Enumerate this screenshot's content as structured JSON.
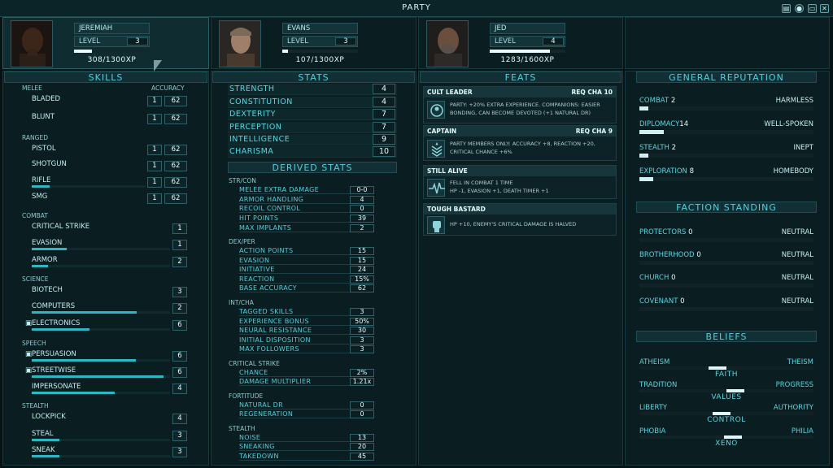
{
  "window": {
    "title": "PARTY"
  },
  "characters": [
    {
      "name": "JEREMIAH",
      "level_label": "LEVEL",
      "level": "3",
      "xp": "308/1300XP",
      "xp_fraction": 0.24
    },
    {
      "name": "EVANS",
      "level_label": "LEVEL",
      "level": "3",
      "xp": "107/1300XP",
      "xp_fraction": 0.08
    },
    {
      "name": "JED",
      "level_label": "LEVEL",
      "level": "4",
      "xp": "1283/1600XP",
      "xp_fraction": 0.8
    }
  ],
  "skills": {
    "title": "SKILLS",
    "accuracy_label": "ACCURACY",
    "melee_label": "MELEE",
    "ranged_label": "RANGED",
    "combat_label": "COMBAT",
    "science_label": "SCIENCE",
    "speech_label": "SPEECH",
    "stealth_label": "STEALTH",
    "bladed": {
      "label": "BLADED",
      "value": "1",
      "acc": "62"
    },
    "blunt": {
      "label": "BLUNT",
      "value": "1",
      "acc": "62"
    },
    "pistol": {
      "label": "PISTOL",
      "value": "1",
      "acc": "62"
    },
    "shotgun": {
      "label": "SHOTGUN",
      "value": "1",
      "acc": "62"
    },
    "rifle": {
      "label": "RIFLE",
      "value": "1",
      "acc": "62"
    },
    "smg": {
      "label": "SMG",
      "value": "1",
      "acc": "62"
    },
    "critical_strike": {
      "label": "CRITICAL STRIKE",
      "value": "1"
    },
    "evasion": {
      "label": "EVASION",
      "value": "1"
    },
    "armor": {
      "label": "ARMOR",
      "value": "2"
    },
    "biotech": {
      "label": "BIOTECH",
      "value": "3"
    },
    "computers": {
      "label": "COMPUTERS",
      "value": "2"
    },
    "electronics": {
      "label": "ELECTRONICS",
      "value": "6"
    },
    "persuasion": {
      "label": "PERSUASION",
      "value": "6"
    },
    "streetwise": {
      "label": "STREETWISE",
      "value": "6"
    },
    "impersonate": {
      "label": "IMPERSONATE",
      "value": "4"
    },
    "lockpick": {
      "label": "LOCKPICK",
      "value": "4"
    },
    "steal": {
      "label": "STEAL",
      "value": "3"
    },
    "sneak": {
      "label": "SNEAK",
      "value": "3"
    }
  },
  "stats": {
    "title": "STATS",
    "strength": {
      "label": "STRENGTH",
      "value": "4"
    },
    "constitution": {
      "label": "CONSTITUTION",
      "value": "4"
    },
    "dexterity": {
      "label": "DEXTERITY",
      "value": "7"
    },
    "perception": {
      "label": "PERCEPTION",
      "value": "7"
    },
    "intelligence": {
      "label": "INTELLIGENCE",
      "value": "9"
    },
    "charisma": {
      "label": "CHARISMA",
      "value": "10"
    }
  },
  "derived": {
    "title": "DERIVED STATS",
    "str_con": "STR/CON",
    "dex_per": "DEX/PER",
    "int_cha": "INT/CHA",
    "critical_strike": "CRITICAL STRIKE",
    "fortitude": "FORTITUDE",
    "stealth": "STEALTH",
    "melee_extra_damage": {
      "label": "MELEE EXTRA DAMAGE",
      "value": "0-0"
    },
    "armor_handling": {
      "label": "ARMOR HANDLING",
      "value": "4"
    },
    "recoil_control": {
      "label": "RECOIL CONTROL",
      "value": "0"
    },
    "hit_points": {
      "label": "HIT POINTS",
      "value": "39"
    },
    "max_implants": {
      "label": "MAX IMPLANTS",
      "value": "2"
    },
    "action_points": {
      "label": "ACTION POINTS",
      "value": "15"
    },
    "evasion": {
      "label": "EVASION",
      "value": "15"
    },
    "initiative": {
      "label": "INITIATIVE",
      "value": "24"
    },
    "reaction": {
      "label": "REACTION",
      "value": "15%"
    },
    "base_accuracy": {
      "label": "BASE ACCURACY",
      "value": "62"
    },
    "tagged_skills": {
      "label": "TAGGED SKILLS",
      "value": "3"
    },
    "experience_bonus": {
      "label": "EXPERIENCE BONUS",
      "value": "50%"
    },
    "neural_resistance": {
      "label": "NEURAL RESISTANCE",
      "value": "30"
    },
    "initial_disposition": {
      "label": "INITIAL DISPOSITION",
      "value": "3"
    },
    "max_followers": {
      "label": "MAX FOLLOWERS",
      "value": "3"
    },
    "chance": {
      "label": "CHANCE",
      "value": "2%"
    },
    "damage_multiplier": {
      "label": "DAMAGE MULTIPLIER",
      "value": "1.21x"
    },
    "natural_dr": {
      "label": "NATURAL DR",
      "value": "0"
    },
    "regeneration": {
      "label": "REGENERATION",
      "value": "0"
    },
    "noise": {
      "label": "NOISE",
      "value": "13"
    },
    "sneaking": {
      "label": "SNEAKING",
      "value": "20"
    },
    "takedown": {
      "label": "TAKEDOWN",
      "value": "45"
    }
  },
  "feats": {
    "title": "FEATS",
    "cult_leader": {
      "name": "CULT LEADER",
      "req": "REQ CHA 10",
      "desc": "PARTY: +20% EXTRA EXPERIENCE. COMPANIONS: EASIER BONDING, CAN BECOME DEVOTED (+1 NATURAL DR)"
    },
    "captain": {
      "name": "CAPTAIN",
      "req": "REQ CHA 9",
      "desc": "PARTY MEMBERS ONLY: ACCURACY +8, REACTION +20, CRITICAL CHANCE +6%"
    },
    "still_alive": {
      "name": "STILL ALIVE",
      "desc1": "FELL IN COMBAT 1 TIME",
      "desc2": "HP -1, EVASION +1, DEATH TIMER +1"
    },
    "tough_bastard": {
      "name": "TOUGH BASTARD",
      "desc": "HP +10, ENEMY'S CRITICAL DAMAGE IS HALVED"
    }
  },
  "reputation": {
    "title": "GENERAL REPUTATION",
    "combat": {
      "label": "COMBAT",
      "value": "2",
      "rank": "HARMLESS",
      "fraction": 0.05
    },
    "diplomacy": {
      "label": "DIPLOMACY",
      "value": "14",
      "rank": "WELL-SPOKEN",
      "fraction": 0.14
    },
    "stealth": {
      "label": "STEALTH",
      "value": "2",
      "rank": "INEPT",
      "fraction": 0.05
    },
    "exploration": {
      "label": "EXPLORATION",
      "value": "8",
      "rank": "HOMEBODY",
      "fraction": 0.08
    }
  },
  "factions": {
    "title": "FACTION STANDING",
    "protectors": {
      "label": "PROTECTORS",
      "value": "0",
      "rank": "NEUTRAL"
    },
    "brotherhood": {
      "label": "BROTHERHOOD",
      "value": "0",
      "rank": "NEUTRAL"
    },
    "church": {
      "label": "CHURCH",
      "value": "0",
      "rank": "NEUTRAL"
    },
    "covenant": {
      "label": "COVENANT",
      "value": "0",
      "rank": "NEUTRAL"
    }
  },
  "beliefs": {
    "title": "BELIEFS",
    "faith": {
      "left": "ATHEISM",
      "right": "THEISM",
      "name": "FAITH",
      "position": 0.45
    },
    "values": {
      "left": "TRADITION",
      "right": "PROGRESS",
      "name": "VALUES",
      "position": 0.55
    },
    "control": {
      "left": "LIBERTY",
      "right": "AUTHORITY",
      "name": "CONTROL",
      "position": 0.47
    },
    "xeno": {
      "left": "PHOBIA",
      "right": "PHILIA",
      "name": "XENO",
      "position": 0.53
    }
  },
  "colors": {
    "accent": "#4fd0dc",
    "background": "#061315",
    "panel": "#0a1d20",
    "bar": "#2bb8c4"
  }
}
